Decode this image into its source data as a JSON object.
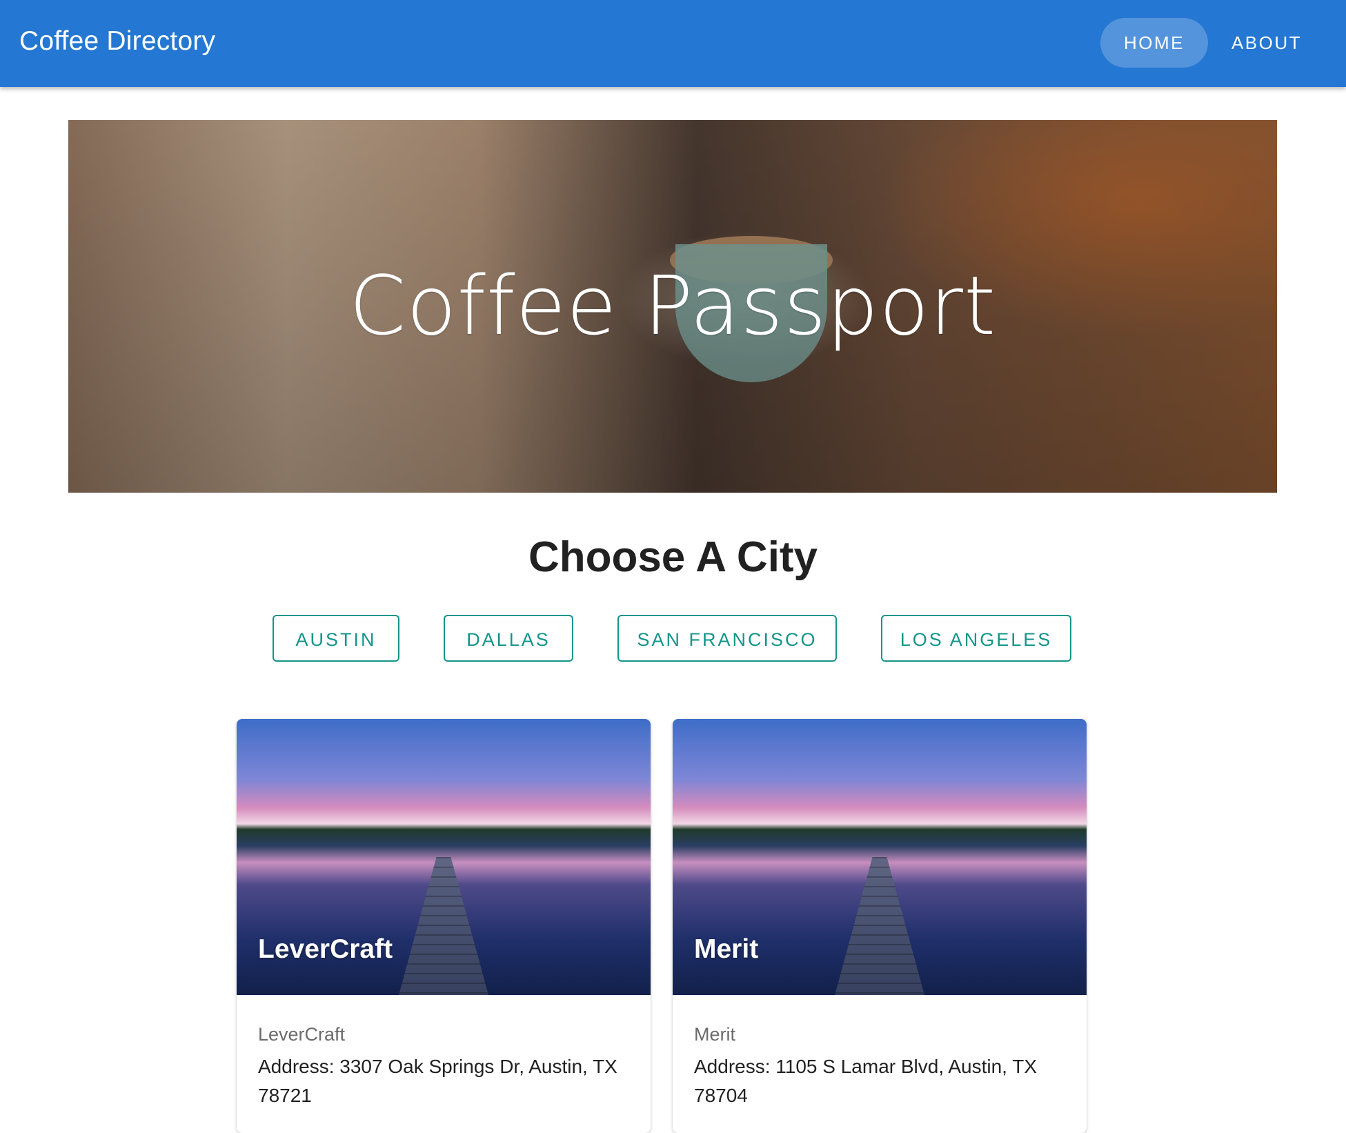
{
  "appbar": {
    "title": "Coffee Directory",
    "nav": [
      {
        "label": "HOME",
        "active": true
      },
      {
        "label": "ABOUT",
        "active": false
      }
    ],
    "color": "#2477d2"
  },
  "hero": {
    "title": "Coffee Passport"
  },
  "cities": {
    "heading": "Choose A City",
    "buttons": [
      "AUSTIN",
      "DALLAS",
      "SAN FRANCISCO",
      "LOS ANGELES"
    ],
    "accent": "#14958a"
  },
  "cards": [
    {
      "media_title": "LeverCraft",
      "subtitle": "LeverCraft",
      "address": "Address: 3307 Oak Springs Dr, Austin, TX 78721"
    },
    {
      "media_title": "Merit",
      "subtitle": "Merit",
      "address": "Address: 1105 S Lamar Blvd, Austin, TX 78704"
    }
  ]
}
